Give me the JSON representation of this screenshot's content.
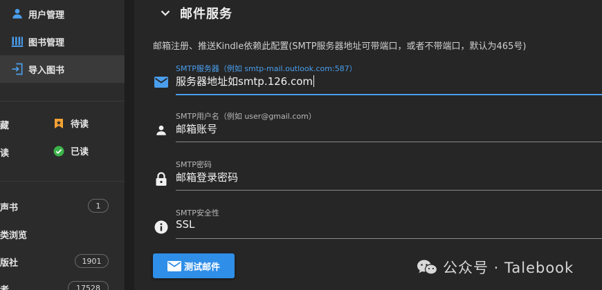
{
  "sidebar": {
    "nav": [
      {
        "label": "用户管理",
        "icon": "person-icon"
      },
      {
        "label": "图书管理",
        "icon": "library-icon"
      },
      {
        "label": "导入图书",
        "icon": "import-icon"
      }
    ],
    "cut_left_1": "藏",
    "cut_left_2": "读",
    "to_read_label": "待读",
    "read_label": "已读",
    "audio_books_label": "声书",
    "audio_books_count": "1",
    "category_label": "类浏览",
    "publisher_label": "版社",
    "publisher_count": "1901",
    "author_label": "者",
    "author_count": "17528"
  },
  "section": {
    "title": "邮件服务",
    "description": "邮箱注册、推送Kindle依赖此配置(SMTP服务器地址可带端口，或者不带端口，默认为465号)"
  },
  "fields": {
    "server": {
      "label": "SMTP服务器（例如 smtp-mail.outlook.com:587）",
      "value": "服务器地址如smtp.126.com"
    },
    "username": {
      "label": "SMTP用户名（例如 user@gmail.com）",
      "value": "邮箱账号"
    },
    "password": {
      "label": "SMTP密码",
      "value": "邮箱登录密码"
    },
    "security": {
      "label": "SMTP安全性",
      "value": "SSL"
    }
  },
  "test_button_label": "测试邮件",
  "watermark_text": "公众号 · Talebook",
  "colors": {
    "accent": "#4a9eed",
    "button": "#2f8ee8",
    "bookmark": "#f4a234",
    "check": "#3cb34a"
  }
}
